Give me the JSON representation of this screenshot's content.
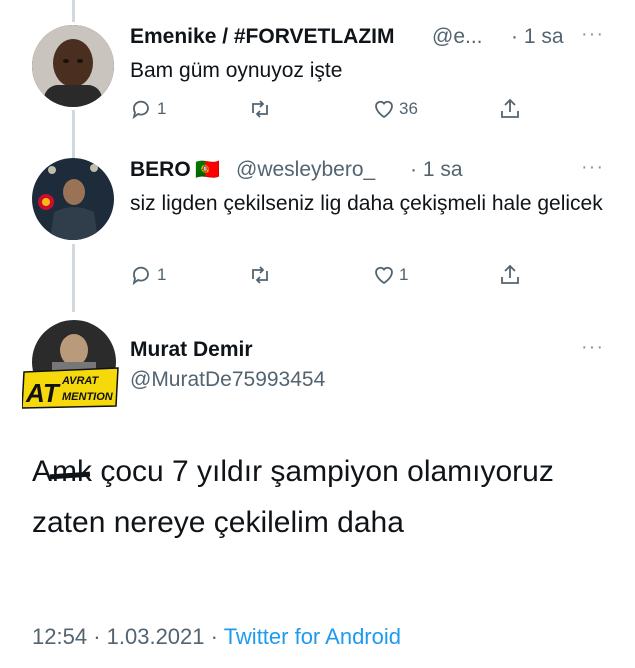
{
  "tweets": [
    {
      "name": "Emenike / #FORVETLAZIM",
      "handle": "@e...",
      "time": "· 1 sa",
      "text": "Bam güm oynuyoz işte",
      "replies": "1",
      "retweets": "",
      "likes": "36"
    },
    {
      "name": "BERO",
      "flag": "🇵🇹",
      "handle": "@wesleybero_",
      "time": "· 1 sa",
      "text": "siz ligden çekilseniz lig daha çekişmeli hale gelicek",
      "replies": "1",
      "retweets": "",
      "likes": "1"
    }
  ],
  "main_tweet": {
    "name": "Murat Demir",
    "handle": "@MuratDe75993454",
    "avatar_badge_big": "AT",
    "avatar_badge_small_1": "AVRAT",
    "avatar_badge_small_2": "MENTION",
    "text_censored": "Amk",
    "text_rest": " çocu 7 yıldır şampiyon olamıyoruz zaten nereye çekilelim daha",
    "time": "12:54",
    "date": "1.03.2021",
    "source": "Twitter for Android",
    "sep": "·"
  },
  "icons": {
    "reply": "reply-icon",
    "retweet": "retweet-icon",
    "like": "heart-icon",
    "share": "share-icon",
    "more": "more-icon"
  },
  "colors": {
    "link": "#1d9bf0",
    "secondary": "#536471",
    "thread": "#cfd9de"
  }
}
